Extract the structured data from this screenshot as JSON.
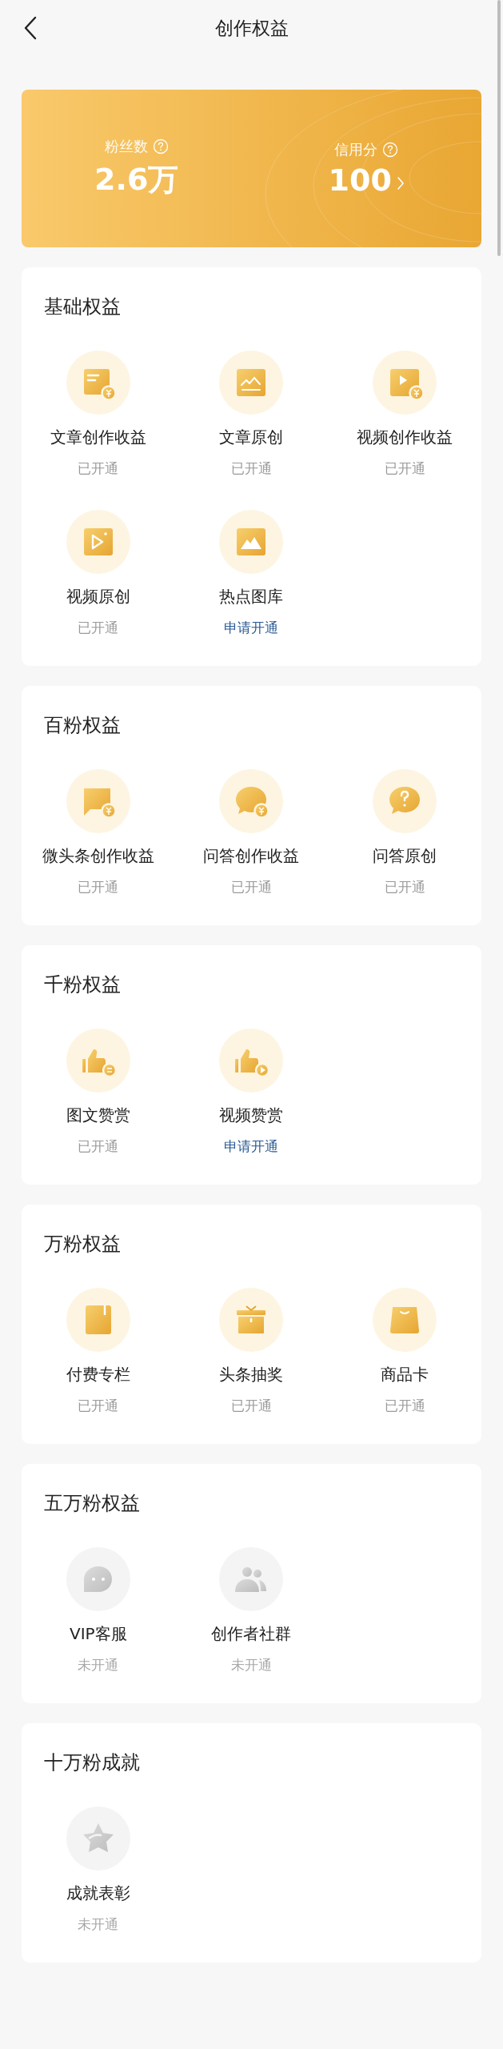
{
  "header": {
    "title": "创作权益"
  },
  "stats": [
    {
      "label": "粉丝数",
      "value": "2.6万"
    },
    {
      "label": "信用分",
      "value": "100",
      "link": true
    }
  ],
  "sections": [
    {
      "title": "基础权益",
      "items": [
        {
          "kind": "doc-coin",
          "label": "文章创作收益",
          "status": "已开通",
          "locked": false,
          "link": false
        },
        {
          "kind": "chart",
          "label": "文章原创",
          "status": "已开通",
          "locked": false,
          "link": false
        },
        {
          "kind": "video-coin",
          "label": "视频创作收益",
          "status": "已开通",
          "locked": false,
          "link": false
        },
        {
          "kind": "video",
          "label": "视频原创",
          "status": "已开通",
          "locked": false,
          "link": false
        },
        {
          "kind": "image",
          "label": "热点图库",
          "status": "申请开通",
          "locked": false,
          "link": true
        }
      ]
    },
    {
      "title": "百粉权益",
      "items": [
        {
          "kind": "flag-coin",
          "label": "微头条创作收益",
          "status": "已开通",
          "locked": false,
          "link": false
        },
        {
          "kind": "bubble-coin",
          "label": "问答创作收益",
          "status": "已开通",
          "locked": false,
          "link": false
        },
        {
          "kind": "bubble-question",
          "label": "问答原创",
          "status": "已开通",
          "locked": false,
          "link": false
        }
      ]
    },
    {
      "title": "千粉权益",
      "items": [
        {
          "kind": "thumb-doc",
          "label": "图文赞赏",
          "status": "已开通",
          "locked": false,
          "link": false
        },
        {
          "kind": "thumb-play",
          "label": "视频赞赏",
          "status": "申请开通",
          "locked": false,
          "link": true
        }
      ]
    },
    {
      "title": "万粉权益",
      "items": [
        {
          "kind": "book",
          "label": "付费专栏",
          "status": "已开通",
          "locked": false,
          "link": false
        },
        {
          "kind": "gift",
          "label": "头条抽奖",
          "status": "已开通",
          "locked": false,
          "link": false
        },
        {
          "kind": "bag",
          "label": "商品卡",
          "status": "已开通",
          "locked": false,
          "link": false
        }
      ]
    },
    {
      "title": "五万粉权益",
      "items": [
        {
          "kind": "chat",
          "label": "VIP客服",
          "status": "未开通",
          "locked": true,
          "link": false
        },
        {
          "kind": "people",
          "label": "创作者社群",
          "status": "未开通",
          "locked": true,
          "link": false
        }
      ]
    },
    {
      "title": "十万粉成就",
      "items": [
        {
          "kind": "star",
          "label": "成就表彰",
          "status": "未开通",
          "locked": true,
          "link": false
        }
      ]
    }
  ]
}
